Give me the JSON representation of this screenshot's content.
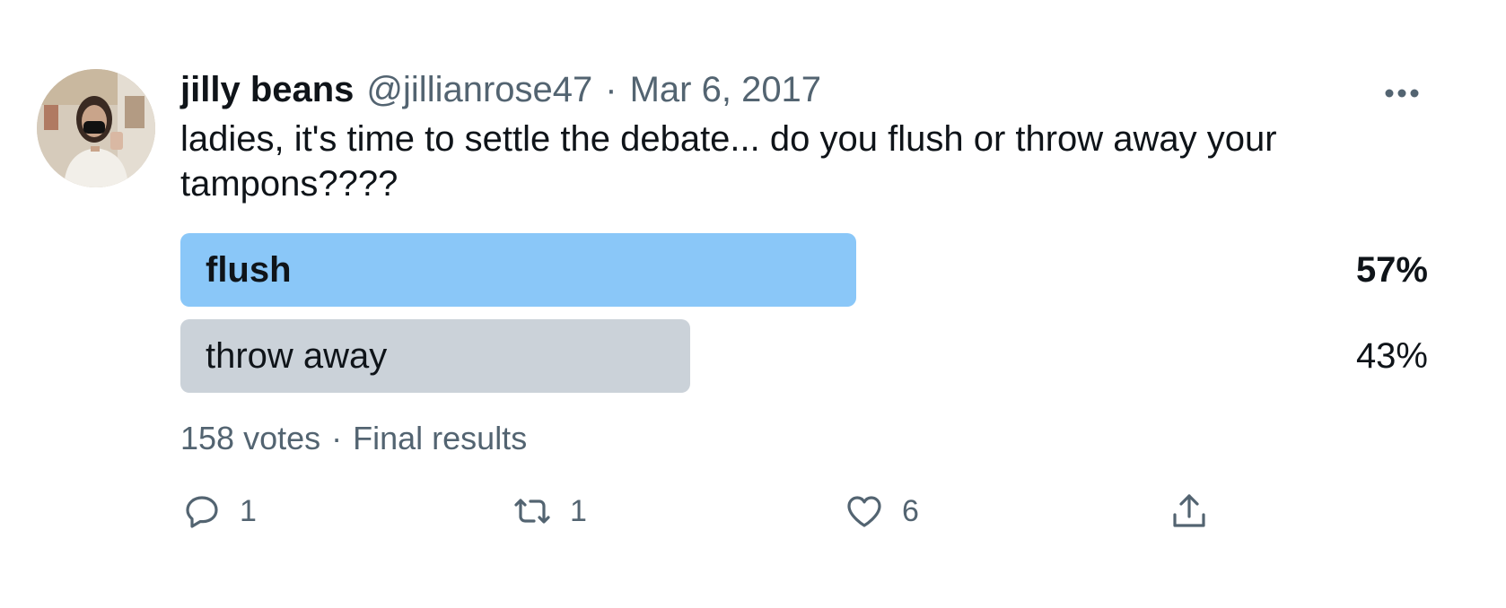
{
  "user": {
    "display_name": "jilly beans",
    "handle": "@jillianrose47",
    "separator": "·",
    "date": "Mar 6, 2017"
  },
  "tweet": {
    "text": "ladies, it's time to settle the debate... do you flush or throw away your tampons????"
  },
  "poll": {
    "options": [
      {
        "label": "flush",
        "percent_text": "57%",
        "percent": 57,
        "winner": true,
        "color": "#8ac7f8"
      },
      {
        "label": "throw away",
        "percent_text": "43%",
        "percent": 43,
        "winner": false,
        "color": "#cbd2d9"
      }
    ],
    "votes": "158 votes",
    "separator": "·",
    "status": "Final results"
  },
  "actions": {
    "reply_count": "1",
    "retweet_count": "1",
    "like_count": "6"
  },
  "icons": {
    "avatar": "profile-photo",
    "more": "more-horizontal-icon",
    "reply": "reply-icon",
    "retweet": "retweet-icon",
    "like": "heart-icon",
    "share": "share-icon"
  },
  "colors": {
    "text_primary": "#0f1419",
    "text_secondary": "#536471",
    "poll_winner": "#8ac7f8",
    "poll_other": "#cbd2d9"
  }
}
